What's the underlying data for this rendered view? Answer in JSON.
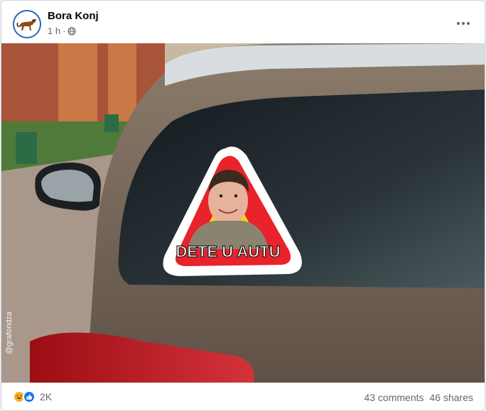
{
  "post": {
    "author": "Bora Konj",
    "time": "1 h",
    "separator": "·",
    "audience_icon": "globe-icon",
    "more_icon": "more-options-icon"
  },
  "image": {
    "sticker_text": "DETE U AUTU",
    "watermark": "@graforidza"
  },
  "footer": {
    "reaction_icons": [
      "haha-icon",
      "like-icon"
    ],
    "reaction_count": "2K",
    "comments": "43 comments",
    "shares": "46 shares"
  },
  "colors": {
    "like_blue": "#1877f2",
    "haha_yellow": "#f7b125",
    "sticker_red": "#e8232b",
    "sticker_yellow": "#f5d21a"
  }
}
